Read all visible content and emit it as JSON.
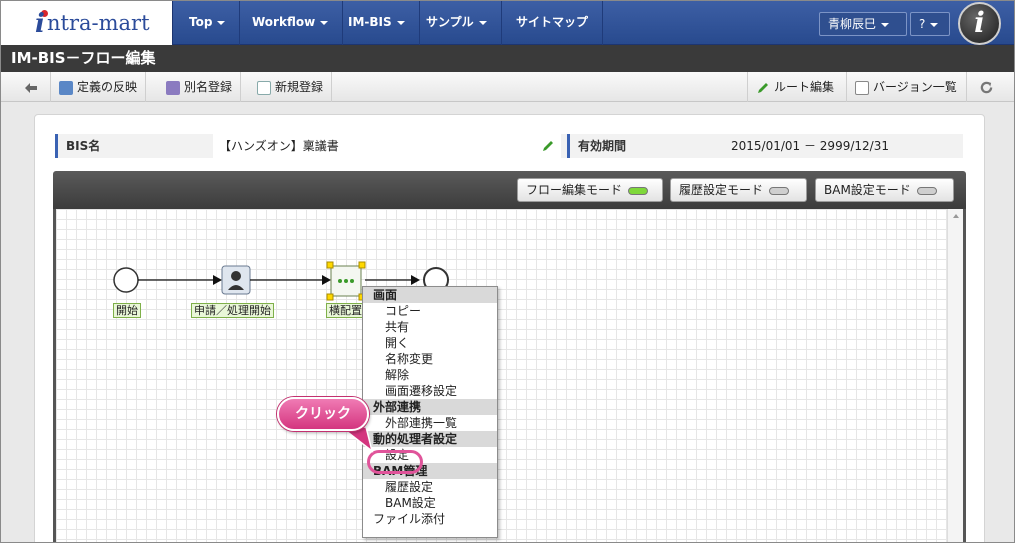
{
  "nav": {
    "items": [
      "Top",
      "Workflow",
      "IM-BIS",
      "サンプル",
      "サイトマップ"
    ],
    "user": "青柳辰巳",
    "help": "?"
  },
  "page_title": "IM-BIS－フロー編集",
  "toolbar": {
    "apply": "定義の反映",
    "alias": "別名登録",
    "new": "新規登録",
    "route_edit": "ルート編集",
    "version_list": "バージョン一覧"
  },
  "info": {
    "bis_label": "BIS名",
    "bis_value": "【ハンズオン】稟議書",
    "period_label": "有効期間",
    "period_value": "2015/01/01 － 2999/12/31"
  },
  "modes": {
    "flow": "フロー編集モード",
    "history": "履歴設定モード",
    "bam": "BAM設定モード"
  },
  "nodes": {
    "start": "開始",
    "apply": "申請／処理開始",
    "parallel": "横配置"
  },
  "menu": {
    "h1": "画面",
    "copy": "コピー",
    "share": "共有",
    "open": "開く",
    "rename": "名称変更",
    "release": "解除",
    "transition": "画面遷移設定",
    "h2": "外部連携",
    "ext_list": "外部連携一覧",
    "h3": "動的処理者設定",
    "setting": "設定",
    "h4": "BAM管理",
    "history": "履歴設定",
    "bam": "BAM設定",
    "attach": "ファイル添付"
  },
  "callout": "クリック",
  "colors": {
    "nav": "#2f519a",
    "accent": "#3a62b3",
    "callout": "#e0549a",
    "led_on": "#7fd83a"
  }
}
